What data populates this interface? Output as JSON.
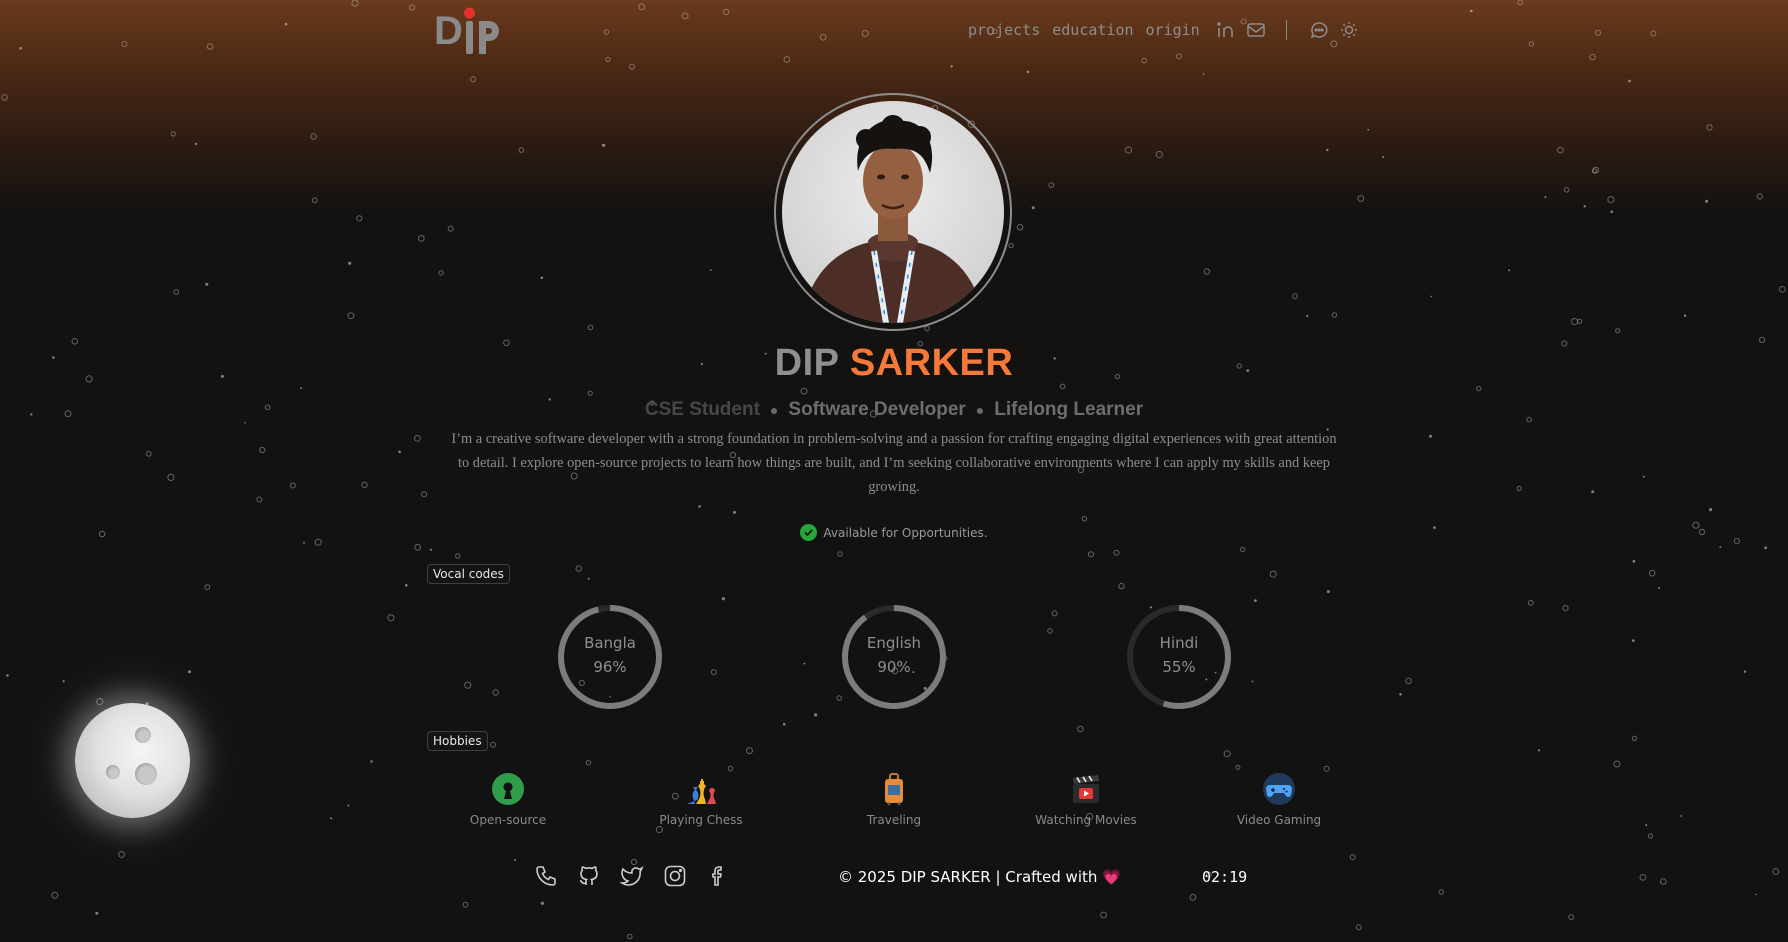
{
  "logo": {
    "text": "DiP"
  },
  "nav": {
    "links": [
      "projects",
      "education",
      "origin"
    ],
    "icons": [
      "linkedin-icon",
      "mail-icon",
      "chat-icon",
      "sun-icon"
    ]
  },
  "profile": {
    "first_name": "DIP",
    "last_name": "SARKER",
    "roles": [
      "CSE Student",
      "Software Developer",
      "Lifelong Learner"
    ],
    "bio": "I’m a creative software developer with a strong foundation in problem-solving and a passion for crafting engaging digital experiences with great attention to detail. I explore open-source projects to learn how things are built, and I’m seeking collaborative environments where I can apply my skills and keep growing.",
    "availability": "Available for Opportunities."
  },
  "vocal_codes": {
    "title": "Vocal codes",
    "languages": [
      {
        "name": "Bangla",
        "percent_label": "96%",
        "value": 0.96
      },
      {
        "name": "English",
        "percent_label": "90%",
        "value": 0.9
      },
      {
        "name": "Hindi",
        "percent_label": "55%",
        "value": 0.55
      }
    ]
  },
  "hobbies": {
    "title": "Hobbies",
    "items": [
      {
        "label": "Open-source",
        "icon": "open-source-icon"
      },
      {
        "label": "Playing Chess",
        "icon": "chess-icon"
      },
      {
        "label": "Traveling",
        "icon": "luggage-icon"
      },
      {
        "label": "Watching Movies",
        "icon": "clapperboard-icon"
      },
      {
        "label": "Video Gaming",
        "icon": "gamepad-icon"
      }
    ]
  },
  "footer": {
    "social_icons": [
      "phone-icon",
      "github-icon",
      "twitter-icon",
      "instagram-icon",
      "facebook-icon"
    ],
    "copyright": "© 2025 DIP SARKER | Crafted with",
    "heart": "💗",
    "clock": "02:19"
  },
  "colors": {
    "accent": "#f47a3c",
    "available": "#27a63d",
    "top_glow": "#6a3a1c",
    "background": "#121212"
  }
}
